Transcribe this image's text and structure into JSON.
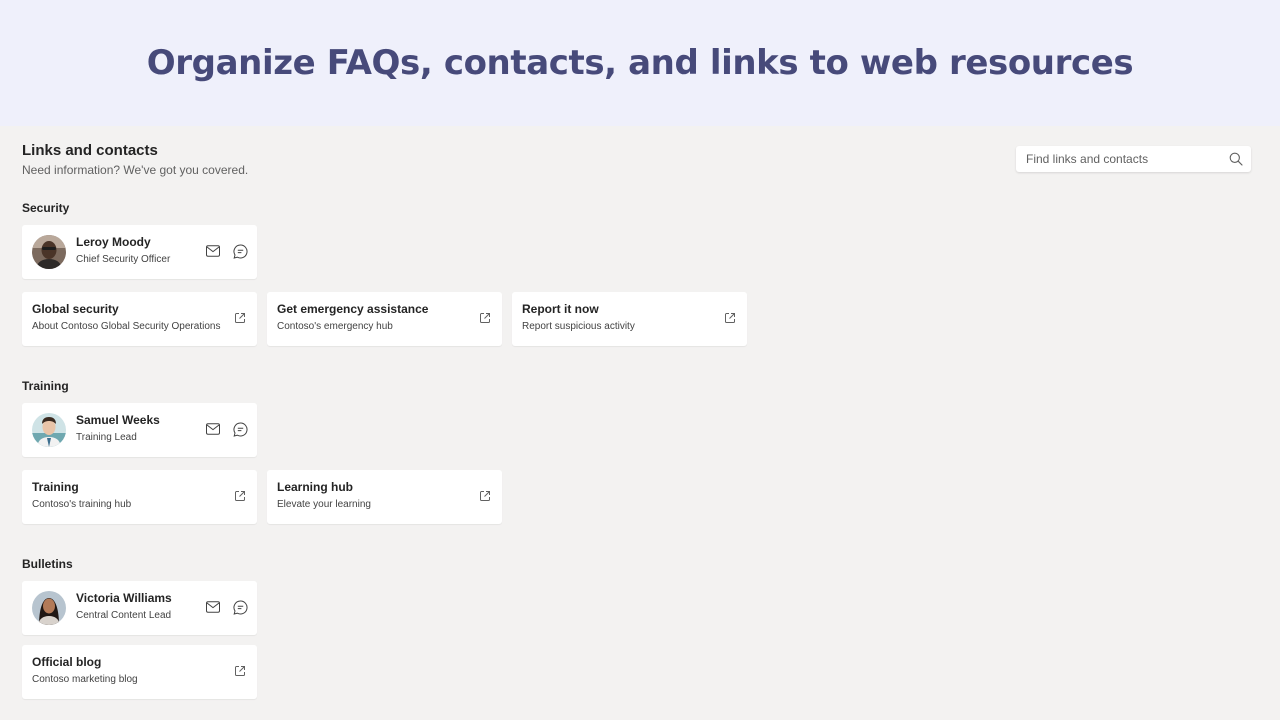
{
  "banner": {
    "title": "Organize FAQs, contacts, and links to web resources"
  },
  "header": {
    "title": "Links and contacts",
    "subtitle": "Need information? We've got you covered."
  },
  "search": {
    "placeholder": "Find links and contacts",
    "icon": "search-icon"
  },
  "sections": [
    {
      "title": "Security",
      "contact": {
        "name": "Leroy Moody",
        "role": "Chief Security Officer"
      },
      "links": [
        {
          "title": "Global security",
          "subtitle": "About Contoso Global Security Operations"
        },
        {
          "title": "Get emergency assistance",
          "subtitle": "Contoso's emergency hub"
        },
        {
          "title": "Report it now",
          "subtitle": "Report suspicious activity"
        }
      ]
    },
    {
      "title": "Training",
      "contact": {
        "name": "Samuel Weeks",
        "role": "Training Lead"
      },
      "links": [
        {
          "title": "Training",
          "subtitle": "Contoso's training hub"
        },
        {
          "title": "Learning hub",
          "subtitle": "Elevate your learning"
        }
      ]
    },
    {
      "title": "Bulletins",
      "contact": {
        "name": "Victoria Williams",
        "role": "Central Content Lead"
      },
      "links": [
        {
          "title": "Official blog",
          "subtitle": "Contoso marketing blog"
        }
      ]
    }
  ],
  "colors": {
    "banner_bg": "#eff0fb",
    "banner_text": "#474a7a",
    "page_bg": "#f3f2f1",
    "card_bg": "#ffffff"
  }
}
